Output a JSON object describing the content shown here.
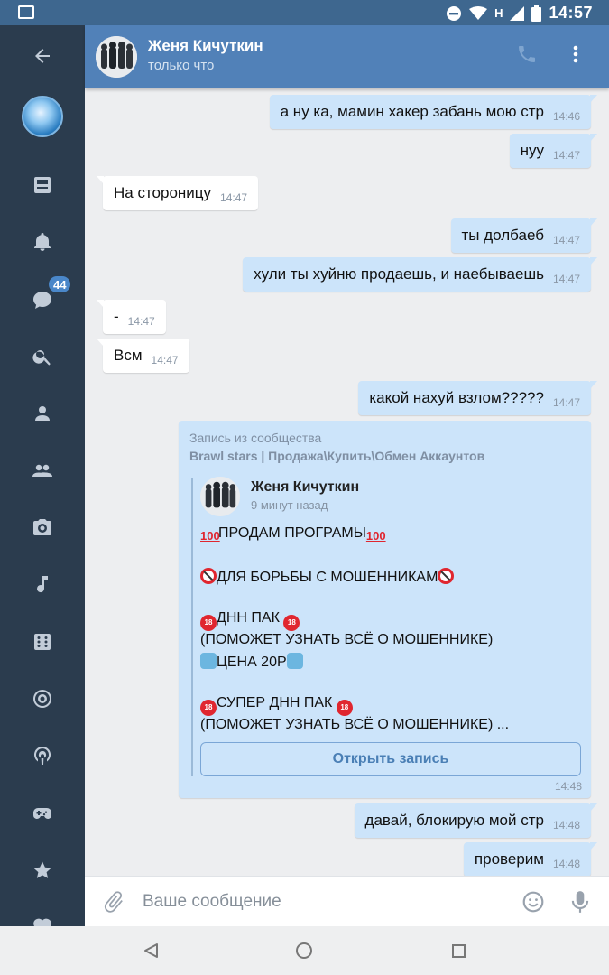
{
  "status_bar": {
    "time": "14:57",
    "network": "H"
  },
  "header": {
    "name": "Женя Кичуткин",
    "status": "только что"
  },
  "rail": {
    "badge": "44"
  },
  "messages": [
    {
      "text": "а ну ка, мамин хакер забань мою стр",
      "time": "14:46",
      "dir": "out"
    },
    {
      "text": "нуу",
      "time": "14:47",
      "dir": "out"
    },
    {
      "text": "На стороницу",
      "time": "14:47",
      "dir": "in"
    },
    {
      "text": "ты долбаеб",
      "time": "14:47",
      "dir": "out"
    },
    {
      "text": "хули ты хуйню продаешь, и наебываешь",
      "time": "14:47",
      "dir": "out"
    },
    {
      "text": "-",
      "time": "14:47",
      "dir": "in"
    },
    {
      "text": "Всм",
      "time": "14:47",
      "dir": "in"
    },
    {
      "text": "какой нахуй взлом?????",
      "time": "14:47",
      "dir": "out"
    },
    {
      "text": "давай, блокирую мой стр",
      "time": "14:48",
      "dir": "out"
    },
    {
      "text": "проверим",
      "time": "14:48",
      "dir": "out"
    }
  ],
  "repost": {
    "label": "Запись из сообщества",
    "group": "Brawl stars | Продажа\\Купить\\Обмен Аккаунтов",
    "author": "Женя Кичуткин",
    "ago": "9 минут назад",
    "lines": [
      "ПРОДАМ ПРОГРАМЫ",
      "ДЛЯ БОРЬБЫ С МОШЕННИКАМ",
      "ДНН ПАК",
      "(ПОМОЖЕТ УЗНАТЬ ВСЁ О МОШЕННИКЕ)",
      "ЦЕНА 20Р",
      "СУПЕР ДНН ПАК",
      "(ПОМОЖЕТ УЗНАТЬ ВСЁ О МОШЕННИКЕ) ..."
    ],
    "button": "Открыть запись",
    "time": "14:48"
  },
  "input": {
    "placeholder": "Ваше сообщение"
  }
}
